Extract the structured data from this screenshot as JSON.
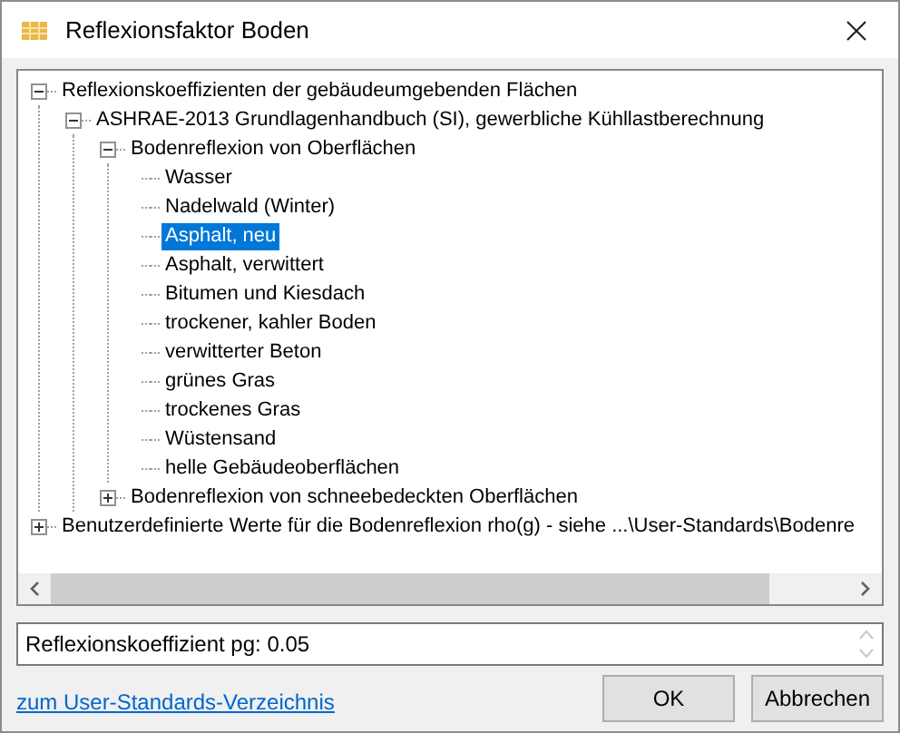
{
  "window": {
    "title": "Reflexionsfaktor Boden"
  },
  "tree": [
    {
      "label": "Reflexionskoeffizienten der gebäudeumgebenden Flächen",
      "expanded": true,
      "selected": false,
      "children": [
        {
          "label": "ASHRAE-2013 Grundlagenhandbuch (SI), gewerbliche Kühllastberechnung",
          "expanded": true,
          "selected": false,
          "children": [
            {
              "label": "Bodenreflexion von Oberflächen",
              "expanded": true,
              "selected": false,
              "children": [
                {
                  "label": "Wasser",
                  "selected": false
                },
                {
                  "label": "Nadelwald (Winter)",
                  "selected": false
                },
                {
                  "label": "Asphalt, neu",
                  "selected": true
                },
                {
                  "label": "Asphalt, verwittert",
                  "selected": false
                },
                {
                  "label": "Bitumen und Kiesdach",
                  "selected": false
                },
                {
                  "label": "trockener, kahler Boden",
                  "selected": false
                },
                {
                  "label": "verwitterter Beton",
                  "selected": false
                },
                {
                  "label": "grünes Gras",
                  "selected": false
                },
                {
                  "label": "trockenes Gras",
                  "selected": false
                },
                {
                  "label": "Wüstensand",
                  "selected": false
                },
                {
                  "label": "helle Gebäudeoberflächen",
                  "selected": false
                }
              ]
            },
            {
              "label": "Bodenreflexion von schneebedeckten Oberflächen",
              "expanded": false,
              "selected": false,
              "kind": "folder"
            }
          ]
        }
      ]
    },
    {
      "label": "Benutzerdefinierte Werte für die Bodenreflexion rho(g) - siehe ...\\User-Standards\\Bodenre",
      "expanded": false,
      "selected": false,
      "kind": "folder"
    }
  ],
  "result": {
    "value": "Reflexionskoeffizient pg: 0.05"
  },
  "link": "zum User-Standards-Verzeichnis",
  "buttons": [
    "OK",
    "Abbrechen"
  ]
}
